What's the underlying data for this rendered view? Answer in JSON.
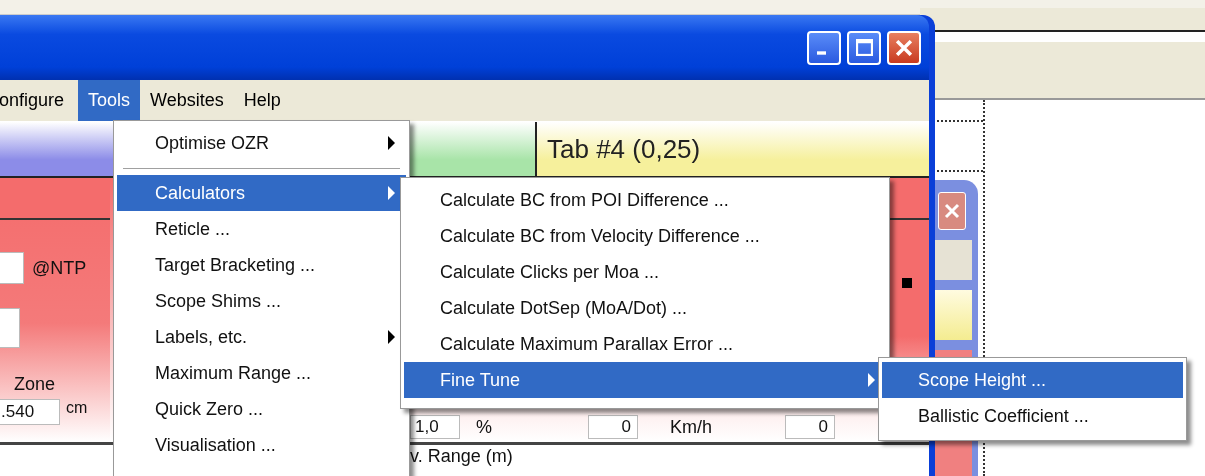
{
  "menu_bar": {
    "items": [
      {
        "label": "onfigure",
        "selected": false
      },
      {
        "label": "Tools",
        "selected": true
      },
      {
        "label": "Websites",
        "selected": false
      },
      {
        "label": "Help",
        "selected": false
      }
    ]
  },
  "tabs": [
    {
      "color": "#8c8ce8"
    },
    {
      "color": "#a8e4a8"
    },
    {
      "label": "Tab #4 (0,25)",
      "color": "#f6f09c"
    }
  ],
  "form": {
    "pressure_unit": "@NTP",
    "zone_label": "Zone",
    "zone_value": ".540",
    "zone_unit": "cm",
    "row": [
      {
        "kind": "field",
        "text": "1,0"
      },
      {
        "kind": "label",
        "text": "%"
      },
      {
        "kind": "field",
        "text": "0"
      },
      {
        "kind": "label",
        "text": "Km/h"
      },
      {
        "kind": "field",
        "text": "0"
      }
    ]
  },
  "chart_title": "v. Range (m)",
  "tools_menu": {
    "items": [
      {
        "kind": "item",
        "label": "Optimise OZR",
        "submenu": true,
        "selected": false
      },
      {
        "kind": "separator"
      },
      {
        "kind": "item",
        "label": "Calculators",
        "submenu": true,
        "selected": true
      },
      {
        "kind": "item",
        "label": "Reticle ...",
        "submenu": false,
        "selected": false
      },
      {
        "kind": "item",
        "label": "Target Bracketing ...",
        "submenu": false,
        "selected": false
      },
      {
        "kind": "item",
        "label": "Scope Shims ...",
        "submenu": false,
        "selected": false
      },
      {
        "kind": "item",
        "label": "Labels, etc.",
        "submenu": true,
        "selected": false
      },
      {
        "kind": "item",
        "label": "Maximum Range ...",
        "submenu": false,
        "selected": false
      },
      {
        "kind": "item",
        "label": "Quick Zero ...",
        "submenu": false,
        "selected": false
      },
      {
        "kind": "item",
        "label": "Visualisation ...",
        "submenu": false,
        "selected": false
      }
    ]
  },
  "calculators_menu": {
    "items": [
      {
        "kind": "item",
        "label": "Calculate BC from POI Difference ...",
        "submenu": false,
        "selected": false
      },
      {
        "kind": "item",
        "label": "Calculate BC from Velocity Difference ...",
        "submenu": false,
        "selected": false
      },
      {
        "kind": "item",
        "label": "Calculate Clicks per Moa ...",
        "submenu": false,
        "selected": false
      },
      {
        "kind": "item",
        "label": "Calculate DotSep (MoA/Dot) ...",
        "submenu": false,
        "selected": false
      },
      {
        "kind": "item",
        "label": "Calculate Maximum Parallax Error ...",
        "submenu": false,
        "selected": false
      },
      {
        "kind": "item",
        "label": "Fine Tune",
        "submenu": true,
        "selected": true
      }
    ]
  },
  "fine_tune_menu": {
    "items": [
      {
        "kind": "item",
        "label": "Scope Height ...",
        "submenu": false,
        "selected": true
      },
      {
        "kind": "item",
        "label": "Ballistic Coefficient ...",
        "submenu": false,
        "selected": false
      }
    ]
  }
}
